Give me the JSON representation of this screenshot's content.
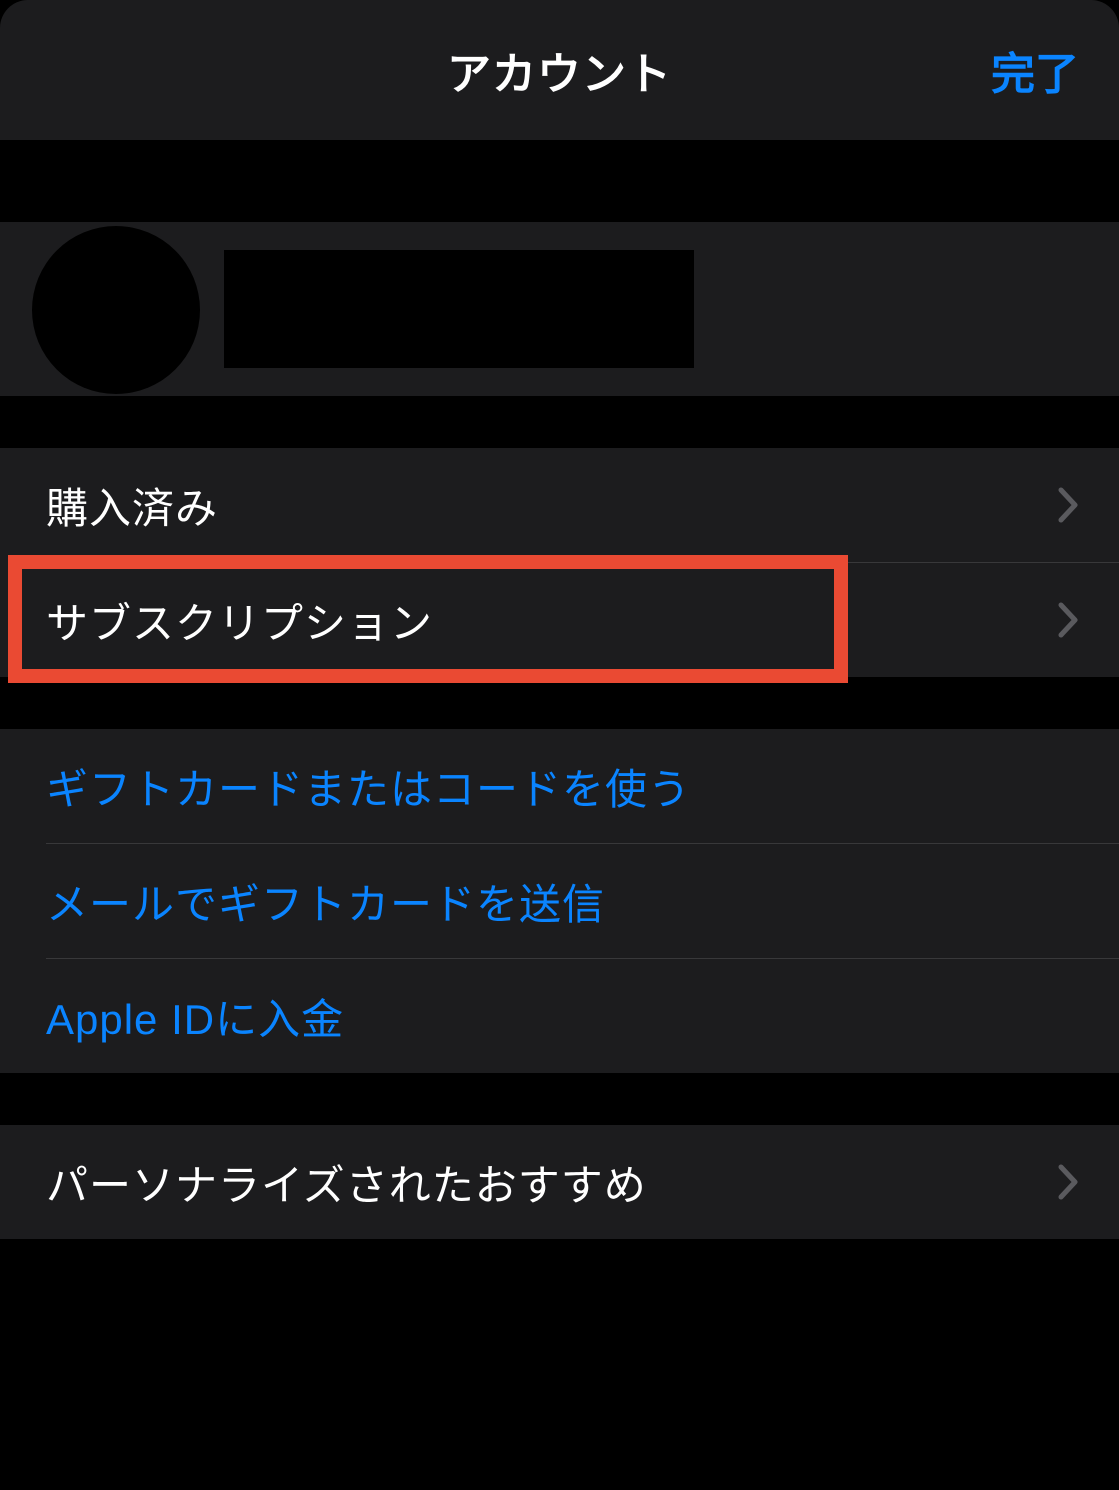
{
  "header": {
    "title": "アカウント",
    "done_label": "完了"
  },
  "menu": {
    "purchased": "購入済み",
    "subscriptions": "サブスクリプション",
    "redeem_gift_card": "ギフトカードまたはコードを使う",
    "send_gift_card": "メールでギフトカードを送信",
    "add_funds": "Apple IDに入金",
    "personalized_recommendations": "パーソナライズされたおすすめ"
  }
}
